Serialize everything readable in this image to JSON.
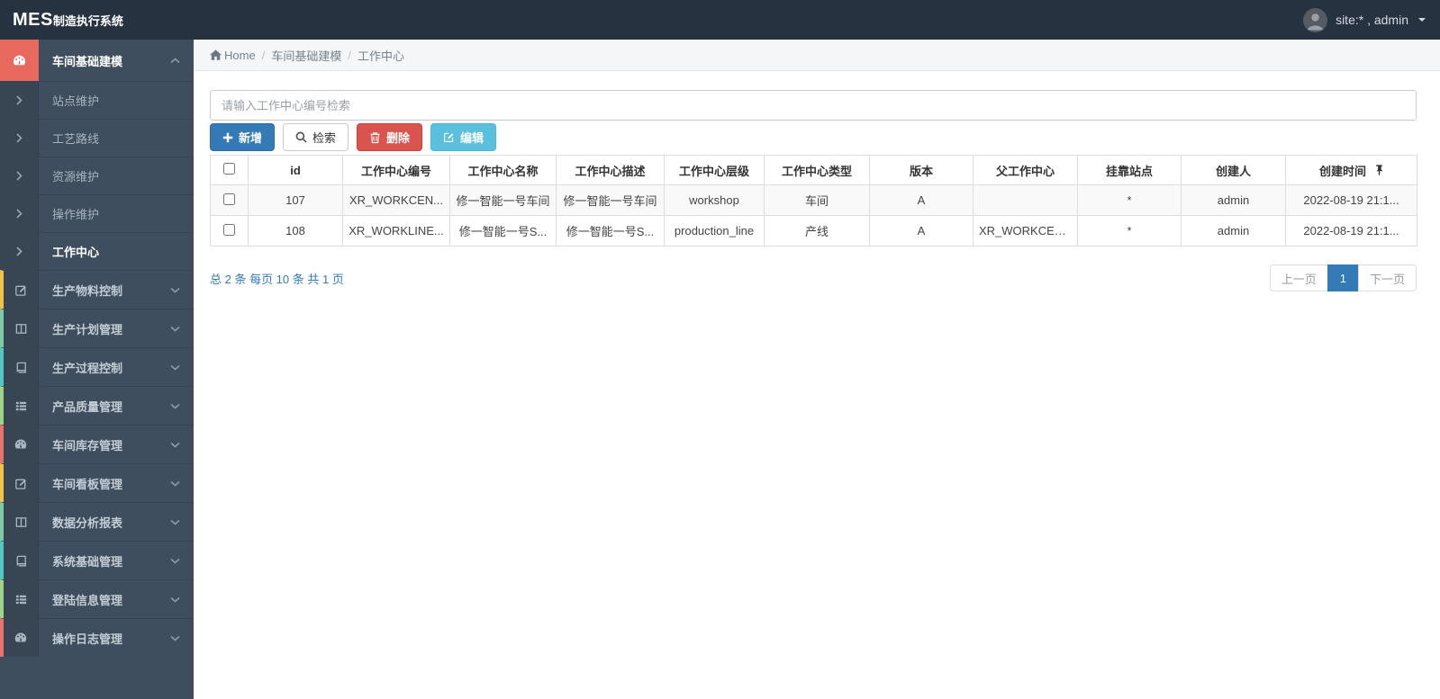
{
  "navbar": {
    "brand_bold": "MES",
    "brand_suffix": "制造执行系统",
    "user_label": "site:* , admin"
  },
  "sidebar": {
    "active_group": {
      "label": "车间基础建模",
      "icon": "dashboard-icon"
    },
    "sub_items": [
      {
        "label": "站点维护",
        "active": false
      },
      {
        "label": "工艺路线",
        "active": false
      },
      {
        "label": "资源维护",
        "active": false
      },
      {
        "label": "操作维护",
        "active": false
      },
      {
        "label": "工作中心",
        "active": true
      }
    ],
    "groups": [
      {
        "label": "生产物料控制",
        "icon": "edit-icon",
        "strip_color": "#f0c14b"
      },
      {
        "label": "生产计划管理",
        "icon": "columns-icon",
        "strip_color": "#7fc9a5"
      },
      {
        "label": "生产过程控制",
        "icon": "book-icon",
        "strip_color": "#56c6c3"
      },
      {
        "label": "产品质量管理",
        "icon": "list-icon",
        "strip_color": "#9fd489"
      },
      {
        "label": "车间库存管理",
        "icon": "dashboard-icon",
        "strip_color": "#e8736c"
      },
      {
        "label": "车间看板管理",
        "icon": "edit-icon",
        "strip_color": "#f0c14b"
      },
      {
        "label": "数据分析报表",
        "icon": "columns-icon",
        "strip_color": "#7fc9a5"
      },
      {
        "label": "系统基础管理",
        "icon": "book-icon",
        "strip_color": "#56c6c3"
      },
      {
        "label": "登陆信息管理",
        "icon": "list-icon",
        "strip_color": "#9fd489"
      },
      {
        "label": "操作日志管理",
        "icon": "dashboard-icon",
        "strip_color": "#e8736c"
      }
    ]
  },
  "breadcrumb": {
    "home": "Home",
    "items": [
      "车间基础建模",
      "工作中心"
    ]
  },
  "toolbar": {
    "search_placeholder": "请输入工作中心编号检索",
    "add_label": "新增",
    "search_label": "检索",
    "delete_label": "删除",
    "edit_label": "编辑"
  },
  "table": {
    "columns": [
      "id",
      "工作中心编号",
      "工作中心名称",
      "工作中心描述",
      "工作中心层级",
      "工作中心类型",
      "版本",
      "父工作中心",
      "挂靠站点",
      "创建人",
      "创建时间"
    ],
    "rows": [
      {
        "checked": false,
        "cells": [
          "107",
          "XR_WORKCEN...",
          "修一智能一号车间",
          "修一智能一号车间",
          "workshop",
          "车间",
          "A",
          "",
          "*",
          "admin",
          "2022-08-19 21:1..."
        ]
      },
      {
        "checked": false,
        "cells": [
          "108",
          "XR_WORKLINE...",
          "修一智能一号S...",
          "修一智能一号S...",
          "production_line",
          "产线",
          "A",
          "XR_WORKCEN...",
          "*",
          "admin",
          "2022-08-19 21:1..."
        ]
      }
    ]
  },
  "pagination": {
    "summary": "总 2 条 每页 10 条 共 1 页",
    "prev_label": "上一页",
    "current_page": "1",
    "next_label": "下一页"
  },
  "colors": {
    "navbar_bg": "#273240",
    "sidebar_bg": "#3f4e5e",
    "active_icon_block": "#e8695e",
    "primary": "#337ab7",
    "danger": "#d9534f",
    "info": "#5bc0de",
    "breadcrumb_bg": "#f5f6f7"
  }
}
